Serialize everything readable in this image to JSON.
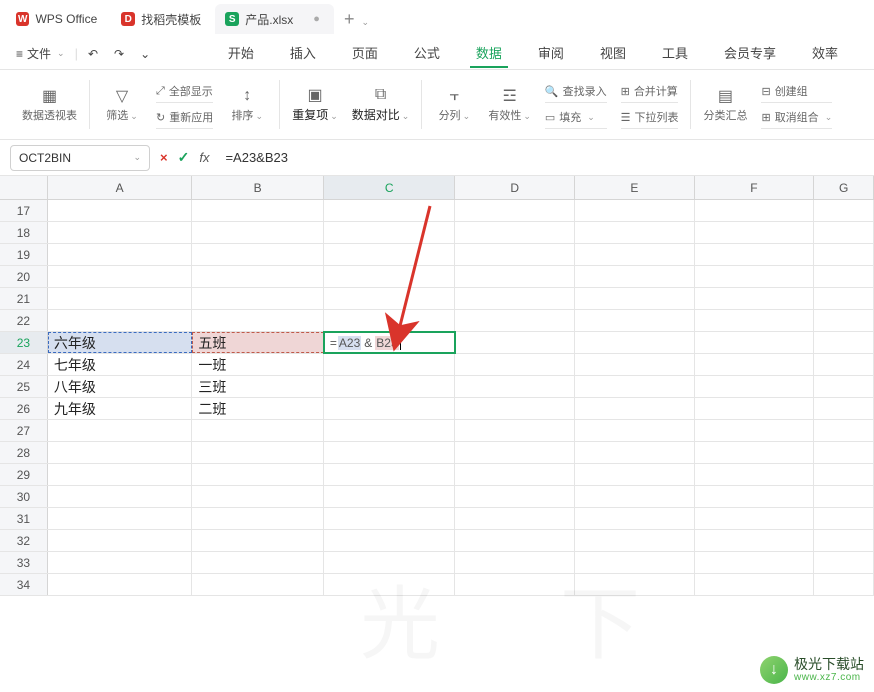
{
  "tabs": {
    "wps_office": "WPS Office",
    "daoke": "找稻壳模板",
    "file": "产品.xlsx",
    "plus": "+"
  },
  "topbar": {
    "menu_icon": "≡",
    "file_label": "文件",
    "sep": "|",
    "undo": "↶",
    "redo": "↷",
    "dd": "⌄",
    "menus": [
      "开始",
      "插入",
      "页面",
      "公式",
      "数据",
      "审阅",
      "视图",
      "工具",
      "会员专享",
      "效率"
    ],
    "active_menu_index": 4
  },
  "ribbon": {
    "pivot": "数据透视表",
    "filter": "筛选",
    "show_all": "全部显示",
    "reapply": "重新应用",
    "sort": "排序",
    "duplicates": "重复项",
    "data_compare": "数据对比",
    "split": "分列",
    "validity": "有效性",
    "find_input": "查找录入",
    "merge_calc": "合并计算",
    "dropdown": "下拉列表",
    "fill": "填充",
    "subtotal": "分类汇总",
    "group": "创建组",
    "ungroup": "取消组合"
  },
  "fxbar": {
    "name": "OCT2BIN",
    "cancel": "×",
    "accept": "✓",
    "fx": "fx",
    "formula": "=A23&B23"
  },
  "grid": {
    "cols": [
      "A",
      "B",
      "C",
      "D",
      "E",
      "F",
      "G"
    ],
    "row_start": 17,
    "row_end": 34,
    "active_row": 23,
    "active_col": "C",
    "data": {
      "23": {
        "A": "六年级",
        "B": "五班"
      },
      "24": {
        "A": "七年级",
        "B": "一班"
      },
      "25": {
        "A": "八年级",
        "B": "三班"
      },
      "26": {
        "A": "九年级",
        "B": "二班"
      }
    },
    "formula_parts": {
      "eq": "=",
      "ref1": "A23",
      "amp": "&",
      "ref2": "B23"
    }
  },
  "watermark": {
    "title": "极光下载站",
    "url": "www.xz7.com",
    "arrow": "↓"
  }
}
